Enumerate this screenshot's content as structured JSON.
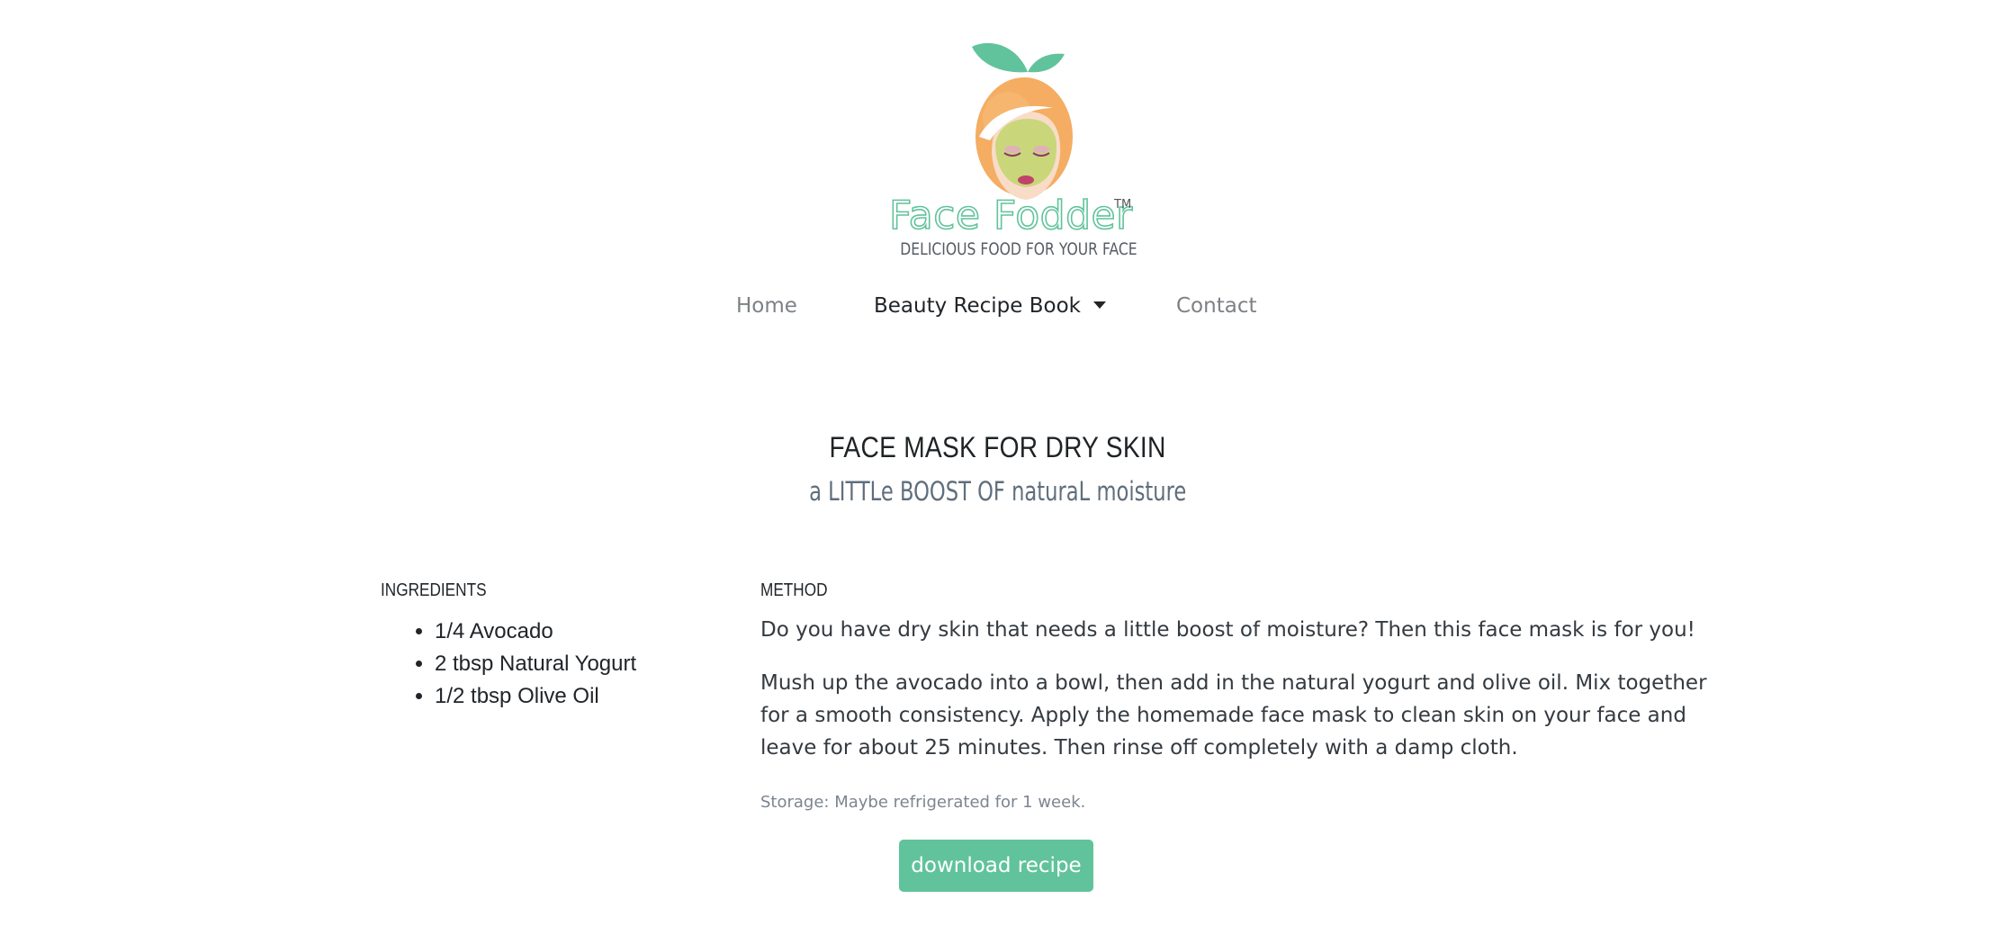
{
  "brand": {
    "name": "Face Fodder",
    "trademark": "TM",
    "tagline": "DELICIOUS FOOD FOR YOUR FACE"
  },
  "nav": {
    "home": "Home",
    "recipe_book": "Beauty Recipe Book",
    "contact": "Contact"
  },
  "recipe": {
    "title": "FACE MASK FOR DRY SKIN",
    "subtitle": "a LITTLe BOOST OF naturaL moisture",
    "ingredients_heading": "INGREDIENTS",
    "ingredients": [
      "1/4 Avocado",
      "2 tbsp Natural Yogurt",
      "1/2 tbsp Olive Oil"
    ],
    "method_heading": "METHOD",
    "method_intro": "Do you have dry skin that needs a little boost of moisture? Then this face mask is for you!",
    "method_steps": "Mush up the avocado into a bowl, then add in the natural yogurt and olive oil. Mix together for a smooth consistency. Apply the homemade face mask to clean skin on your face and leave for about 25 minutes. Then rinse off completely with a damp cloth.",
    "storage": "Storage: Maybe refrigerated for 1 week.",
    "download_label": "download recipe"
  },
  "colors": {
    "accent": "#61c39b",
    "hair": "#f4ad62",
    "face_mask": "#c9d77a"
  },
  "icons": {
    "logo": "woman-with-face-mask-and-orange-hair-logo",
    "dropdown": "caret-down-icon"
  }
}
